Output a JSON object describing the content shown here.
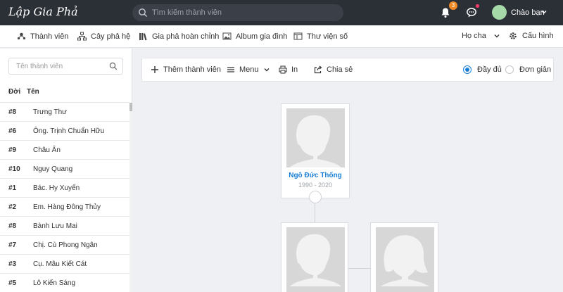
{
  "header": {
    "logo": "Lập Gia Phả",
    "search_placeholder": "Tìm kiếm thành viên",
    "notification_count": "3",
    "greeting": "Chào bạn"
  },
  "nav": {
    "items": [
      {
        "label": "Thành viên",
        "icon": "members-icon"
      },
      {
        "label": "Cây phả hệ",
        "icon": "tree-icon"
      },
      {
        "label": "Gia phả hoàn chỉnh",
        "icon": "books-icon"
      },
      {
        "label": "Album gia đình",
        "icon": "album-icon"
      },
      {
        "label": "Thư viện số",
        "icon": "library-icon"
      }
    ],
    "sort_label": "Họ cha",
    "settings_label": "Cấu hình"
  },
  "sidebar": {
    "filter_placeholder": "Tên thành viên",
    "col_generation": "Đời",
    "col_name": "Tên",
    "rows": [
      {
        "gen": "#8",
        "name": "Trưng Thư"
      },
      {
        "gen": "#6",
        "name": "Ông. Trịnh Chuẩn Hữu"
      },
      {
        "gen": "#9",
        "name": "Châu Ân"
      },
      {
        "gen": "#10",
        "name": "Nguy Quang"
      },
      {
        "gen": "#1",
        "name": "Bác. Hy Xuyến"
      },
      {
        "gen": "#2",
        "name": "Em. Hàng Đông Thủy"
      },
      {
        "gen": "#8",
        "name": "Bành Lưu Mai"
      },
      {
        "gen": "#7",
        "name": "Chị. Cù Phong Ngân"
      },
      {
        "gen": "#3",
        "name": "Cụ. Mâu Kiết Cát"
      },
      {
        "gen": "#5",
        "name": "Lô Kiến Sáng"
      }
    ]
  },
  "toolbar": {
    "add_member": "Thêm thành viên",
    "menu": "Menu",
    "print": "In",
    "share": "Chia sẻ",
    "view_full": "Đầy đủ",
    "view_simple": "Đơn giản",
    "selected_view": "full"
  },
  "tree": {
    "root": {
      "name": "Ngô Đức Thống",
      "years": "1990 - 2020"
    }
  },
  "colors": {
    "header_bg": "#2b2f36",
    "accent": "#1a7fd6",
    "badge": "#f08a24"
  }
}
